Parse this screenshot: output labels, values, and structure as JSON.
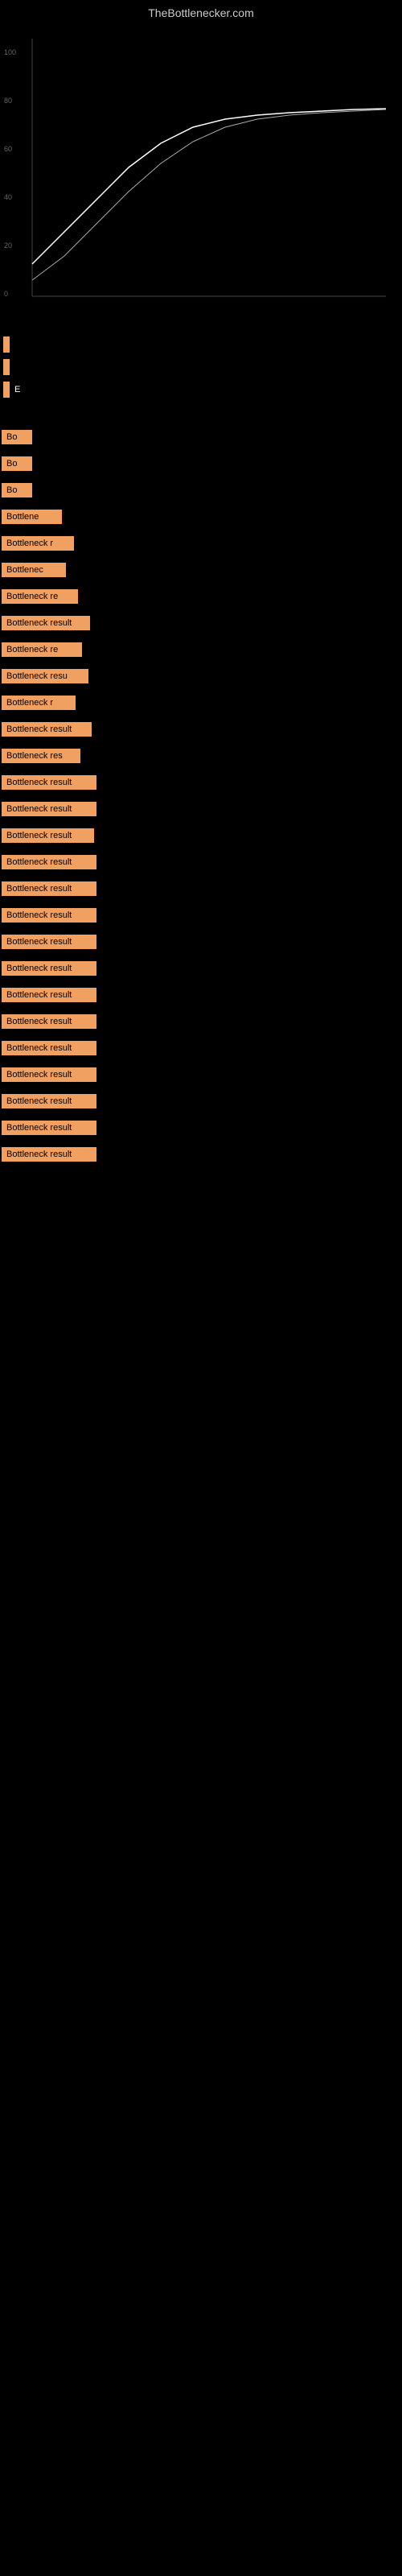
{
  "site": {
    "title": "TheBottlenecker.com"
  },
  "chart": {
    "has_data": true
  },
  "input_rows": [
    {
      "label": "",
      "has_indicator": true
    },
    {
      "label": "",
      "has_indicator": true
    },
    {
      "label": "E",
      "has_indicator": true
    }
  ],
  "result_items": [
    {
      "label": "Bo",
      "width": 38
    },
    {
      "label": "Bo",
      "width": 38
    },
    {
      "label": "Bo",
      "width": 38
    },
    {
      "label": "Bottlene",
      "width": 75
    },
    {
      "label": "Bottleneck r",
      "width": 90
    },
    {
      "label": "Bottlenec",
      "width": 80
    },
    {
      "label": "Bottleneck re",
      "width": 95
    },
    {
      "label": "Bottleneck result",
      "width": 110
    },
    {
      "label": "Bottleneck re",
      "width": 100
    },
    {
      "label": "Bottleneck resu",
      "width": 108
    },
    {
      "label": "Bottleneck r",
      "width": 92
    },
    {
      "label": "Bottleneck result",
      "width": 112
    },
    {
      "label": "Bottleneck res",
      "width": 98
    },
    {
      "label": "Bottleneck result",
      "width": 118
    },
    {
      "label": "Bottleneck result",
      "width": 118
    },
    {
      "label": "Bottleneck result",
      "width": 115
    },
    {
      "label": "Bottleneck result",
      "width": 118
    },
    {
      "label": "Bottleneck result",
      "width": 118
    },
    {
      "label": "Bottleneck result",
      "width": 118
    },
    {
      "label": "Bottleneck result",
      "width": 118
    },
    {
      "label": "Bottleneck result",
      "width": 118
    },
    {
      "label": "Bottleneck result",
      "width": 118
    },
    {
      "label": "Bottleneck result",
      "width": 118
    },
    {
      "label": "Bottleneck result",
      "width": 118
    },
    {
      "label": "Bottleneck result",
      "width": 118
    },
    {
      "label": "Bottleneck result",
      "width": 118
    },
    {
      "label": "Bottleneck result",
      "width": 118
    },
    {
      "label": "Bottleneck result",
      "width": 118
    }
  ]
}
